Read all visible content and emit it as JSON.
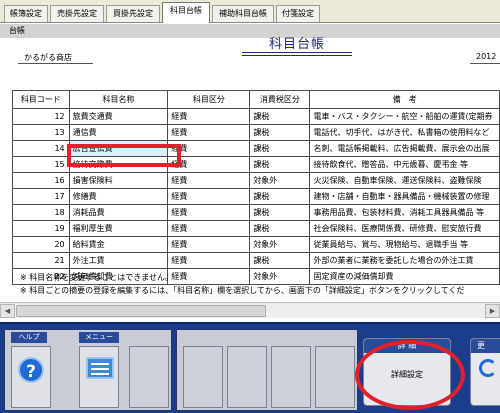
{
  "tabs": [
    {
      "label": "帳簿設定",
      "active": false
    },
    {
      "label": "売掛先設定",
      "active": false
    },
    {
      "label": "買掛先設定",
      "active": false
    },
    {
      "label": "科目台帳",
      "active": true
    },
    {
      "label": "補助科目台帳",
      "active": false
    },
    {
      "label": "付箋設定",
      "active": false
    }
  ],
  "panel": {
    "header": "台帳",
    "title": "科目台帳",
    "company": "かるがる商店",
    "period_fragment": "2012"
  },
  "table": {
    "columns": [
      "科目コード",
      "科目名称",
      "科目区分",
      "消費税区分",
      "備　考"
    ],
    "rows": [
      {
        "code": "12",
        "name": "旅費交通費",
        "category": "経費",
        "tax": "課税",
        "note": "電車・バス・タクシー・航空・船舶の運賃(定期券"
      },
      {
        "code": "13",
        "name": "通信費",
        "category": "経費",
        "tax": "課税",
        "note": "電話代、切手代、はがき代、私書箱の使用料など"
      },
      {
        "code": "14",
        "name": "広告宣伝費",
        "category": "経費",
        "tax": "課税",
        "note": "名刺、電話帳掲載料、広告掲載費、展示会の出展"
      },
      {
        "code": "15",
        "name": "接待交際費",
        "category": "経費",
        "tax": "課税",
        "note": "接待飲食代、贈答品、中元歳暮、慶弔金 等"
      },
      {
        "code": "16",
        "name": "損害保険料",
        "category": "経費",
        "tax": "対象外",
        "note": "火災保険、自動車保険、運送保険料、盗難保険"
      },
      {
        "code": "17",
        "name": "修繕費",
        "category": "経費",
        "tax": "課税",
        "note": "建物・店舗・自動車・器具備品・機械装置の修理"
      },
      {
        "code": "18",
        "name": "消耗品費",
        "category": "経費",
        "tax": "課税",
        "note": "事務用品費、包装材料費、消耗工具器具備品 等"
      },
      {
        "code": "19",
        "name": "福利厚生費",
        "category": "経費",
        "tax": "課税",
        "note": "社会保険料、医療関係費、研修費、慰安旅行費"
      },
      {
        "code": "20",
        "name": "給料賃金",
        "category": "経費",
        "tax": "対象外",
        "note": "従業員給与、賞与、現物給与、退職手当 等"
      },
      {
        "code": "21",
        "name": "外注工賃",
        "category": "経費",
        "tax": "課税",
        "note": "外部の業者に業務を委託した場合の外注工賃"
      },
      {
        "code": "22",
        "name": "減価償却費",
        "category": "経費",
        "tax": "対象外",
        "note": "固定資産の減価償却費"
      }
    ]
  },
  "notes": [
    "※ 科目名称を変更することはできません。",
    "※ 科目ごとの摘要の登録を編集するには、「科目名称」欄を選択してから、画面下の「詳細設定」ボタンをクリックしてくだ"
  ],
  "toolbar": {
    "help_label": "ヘルプ",
    "menu_label": "メニュー",
    "detail_group_label": "詳 細",
    "detail_button_label": "詳細設定",
    "update_label": "更"
  },
  "colors": {
    "toolbar_bg": "#1c3d8c",
    "highlight": "#e0202a",
    "title_blue": "#1f2a78",
    "selected_cell": "#d7f0fb"
  }
}
